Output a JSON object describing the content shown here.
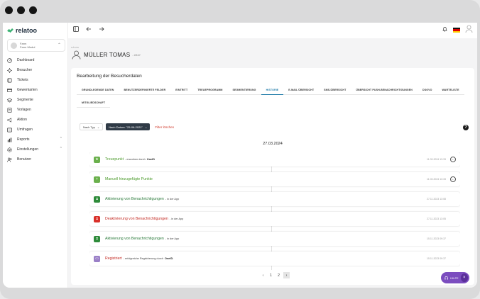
{
  "app": {
    "logo_text": "relatoo"
  },
  "farm_selector": {
    "line1": "Farm",
    "line2": "Farm Modul"
  },
  "sidebar": {
    "items": [
      {
        "label": "Dashboard",
        "icon": "speedometer-icon"
      },
      {
        "label": "Besucher",
        "icon": "sparkle-icon"
      },
      {
        "label": "Tickets",
        "icon": "ticket-icon"
      },
      {
        "label": "Gewerkarten",
        "icon": "card-icon"
      },
      {
        "label": "Segmente",
        "icon": "layers-icon"
      },
      {
        "label": "Vorlagen",
        "icon": "template-icon"
      },
      {
        "label": "Aktion",
        "icon": "megaphone-icon"
      },
      {
        "label": "Umfragen",
        "icon": "survey-icon"
      },
      {
        "label": "Reports",
        "icon": "bar-chart-icon",
        "expandable": true
      },
      {
        "label": "Einstellungen",
        "icon": "gear-icon",
        "expandable": true
      },
      {
        "label": "Benutzer",
        "icon": "users-icon"
      }
    ]
  },
  "page": {
    "breadcrumb": "GÄSTE",
    "person_name": "MÜLLER TOMAS",
    "person_id": "- #932",
    "section_title": "Bearbeitung der Besucherdaten"
  },
  "tabs_row1": [
    {
      "label": "GRUNDLEGENDE DATEN",
      "active": false
    },
    {
      "label": "BENUTZERDEFINIERTE FELDER",
      "active": false
    },
    {
      "label": "EINTRITT",
      "active": false
    },
    {
      "label": "TREUEPROGRAMM",
      "active": false
    },
    {
      "label": "SEGMENTIERUNG",
      "active": false
    },
    {
      "label": "HISTORIE",
      "active": true
    },
    {
      "label": "E-MAIL ÜBERSICHT",
      "active": false
    },
    {
      "label": "SMS-ÜBERSICHT",
      "active": false
    },
    {
      "label": "ÜBERSICHT PUSH-BENACHRICHTIGUNGEN",
      "active": false
    },
    {
      "label": "DSGVO",
      "active": false
    },
    {
      "label": "WARTELISTE",
      "active": false
    }
  ],
  "tabs_row2": [
    {
      "label": "MITGLIEDSCHAFT",
      "active": false
    }
  ],
  "filters": {
    "type_select": "Nach Typ",
    "date_chip": "Nach Datum: \"25-06-2021\"",
    "clear_label": "Filter löschen"
  },
  "history": {
    "date": "27.03.2024",
    "entries": [
      {
        "title": "Treuepunkt",
        "desc": "- erworben durch",
        "desc_bold": "OneID",
        "time": "11.03.2024 13:33",
        "color": "#6ab04c",
        "title_color": "#4a9a2a",
        "icon": "star-icon",
        "action": true
      },
      {
        "title": "Manuell hinzugefügte Punkte",
        "desc": "",
        "desc_bold": "",
        "time": "11.03.2024 13:33",
        "color": "#6ab04c",
        "title_color": "#4a9a2a",
        "icon": "plus-box-icon",
        "action": true
      },
      {
        "title": "Aktivierung von Benachrichtigungen",
        "desc": "- in der App",
        "desc_bold": "",
        "time": "27.11.2023 13:08",
        "color": "#2e8b3a",
        "title_color": "#2a7a3a",
        "icon": "bell-on-icon",
        "action": false
      },
      {
        "title": "Deaktivierung von Benachrichtigungen",
        "desc": "- in der App",
        "desc_bold": "",
        "time": "27.11.2023 13:05",
        "color": "#d9302a",
        "title_color": "#c42b24",
        "icon": "bell-off-icon",
        "action": false
      },
      {
        "title": "Aktivierung von Benachrichtigungen",
        "desc": "- in der App",
        "desc_bold": "",
        "time": "15.11.2023 09:37",
        "color": "#2e8b3a",
        "title_color": "#2a7a3a",
        "icon": "bell-on-icon",
        "action": false
      },
      {
        "title": "Registriert",
        "desc": "- erfolgreiche Registrierung durch",
        "desc_bold": "OneID.",
        "time": "15.11.2023 09:37",
        "color": "#9a7fc7",
        "title_color": "#c42b24",
        "icon": "register-icon",
        "action": false
      }
    ]
  },
  "pagination": {
    "prev": "‹",
    "pages": [
      "1",
      "2"
    ],
    "current": "2",
    "next": "›"
  },
  "help_widget": {
    "label": "HILFE",
    "close": "×"
  },
  "colors": {
    "accent": "#1e7aa8",
    "brand_green": "#3bb273",
    "danger": "#d0392b",
    "help_purple": "#7b4dbf"
  }
}
